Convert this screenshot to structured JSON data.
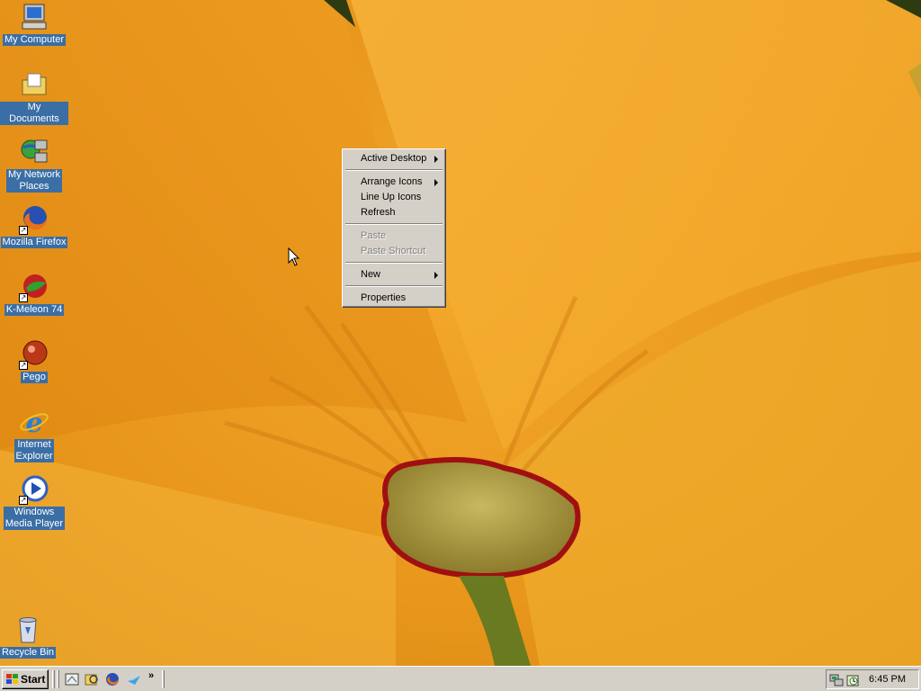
{
  "desktop": {
    "icons": [
      {
        "label": "My Computer",
        "icon": "my-computer-icon"
      },
      {
        "label": "My Documents",
        "icon": "my-documents-icon"
      },
      {
        "label_line1": "My Network",
        "label_line2": "Places",
        "icon": "network-places-icon"
      },
      {
        "label": "Mozilla Firefox",
        "icon": "firefox-icon"
      },
      {
        "label": "K-Meleon 74",
        "icon": "k-meleon-icon"
      },
      {
        "label": "Pego",
        "icon": "pego-icon"
      },
      {
        "label_line1": "Internet",
        "label_line2": "Explorer",
        "icon": "internet-explorer-icon"
      },
      {
        "label_line1": "Windows",
        "label_line2": "Media Player",
        "icon": "media-player-icon"
      },
      {
        "label": "Recycle Bin",
        "icon": "recycle-bin-icon"
      }
    ]
  },
  "context_menu": {
    "items": [
      {
        "label": "Active Desktop",
        "submenu": true,
        "enabled": true
      },
      {
        "label": "Arrange Icons",
        "submenu": true,
        "enabled": true
      },
      {
        "label": "Line Up Icons",
        "submenu": false,
        "enabled": true
      },
      {
        "label": "Refresh",
        "submenu": false,
        "enabled": true
      },
      {
        "label": "Paste",
        "submenu": false,
        "enabled": false
      },
      {
        "label": "Paste Shortcut",
        "submenu": false,
        "enabled": false
      },
      {
        "label": "New",
        "submenu": true,
        "enabled": true
      },
      {
        "label": "Properties",
        "submenu": false,
        "enabled": true
      }
    ]
  },
  "taskbar": {
    "start_label": "Start",
    "quick_launch": [
      "show-desktop-icon",
      "explorer-icon",
      "firefox-icon",
      "outlook-express-icon",
      "chevron-more-icon"
    ],
    "tray_icons": [
      "network-tray-icon",
      "scheduler-tray-icon"
    ],
    "clock": "6:45 PM"
  },
  "colors": {
    "selection_blue": "#3a6ea5",
    "face": "#d4d0c8",
    "wallpaper_orange": "#e79a1c"
  }
}
